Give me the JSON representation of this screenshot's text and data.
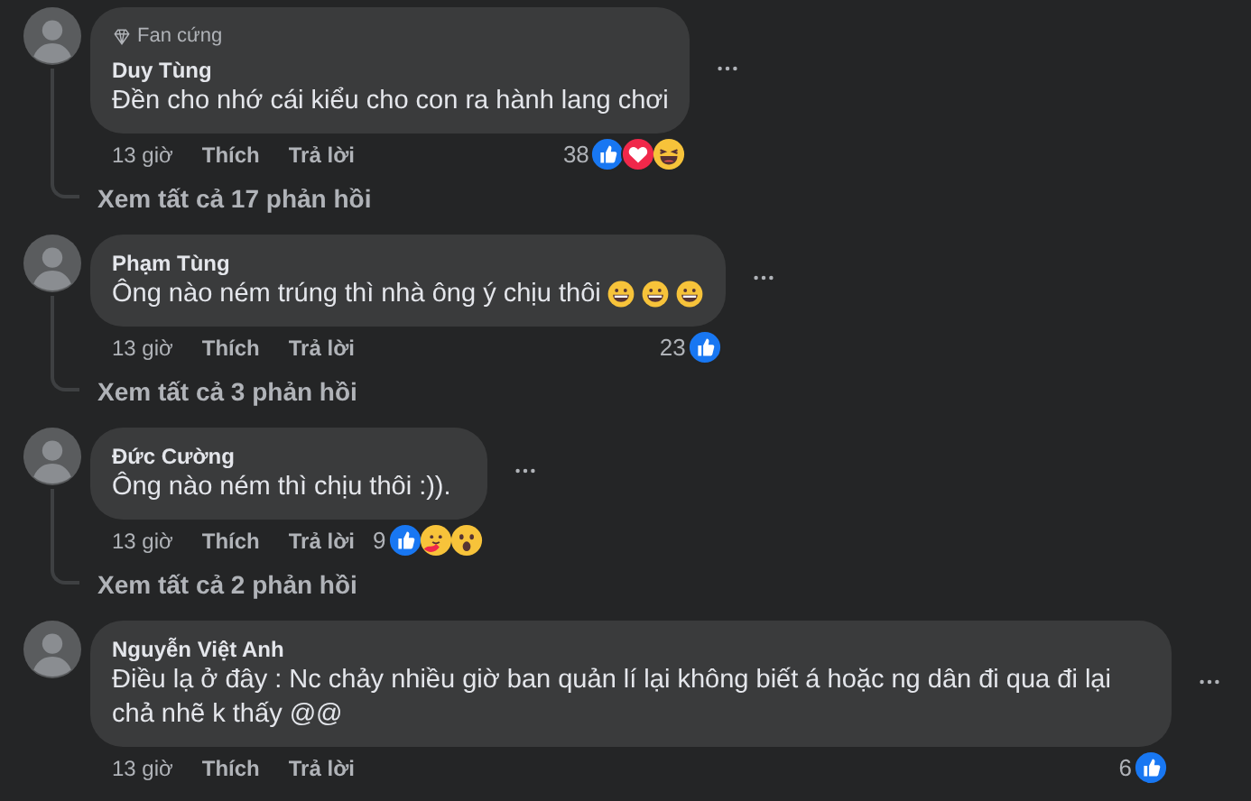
{
  "comments": [
    {
      "badge": "Fan cứng",
      "author": "Duy Tùng",
      "text": "Đền cho nhớ cái kiểu cho con ra hành lang chơi",
      "time": "13 giờ",
      "like": "Thích",
      "reply": "Trả lời",
      "reaction_count": "38",
      "reactions": [
        {
          "kind": "like"
        },
        {
          "kind": "love"
        },
        {
          "kind": "haha"
        }
      ],
      "replies": "Xem tất cả 17 phản hồi"
    },
    {
      "author": "Phạm Tùng",
      "text": "Ông nào ném trúng thì nhà ông ý chịu thôi",
      "emojis": [
        {
          "kind": "grin"
        },
        {
          "kind": "grin"
        },
        {
          "kind": "grin"
        }
      ],
      "time": "13 giờ",
      "like": "Thích",
      "reply": "Trả lời",
      "reaction_count": "23",
      "reactions": [
        {
          "kind": "like"
        }
      ],
      "replies": "Xem tất cả 3 phản hồi"
    },
    {
      "author": "Đức Cường",
      "text": "Ông nào ném thì chịu thôi :)).",
      "time": "13 giờ",
      "like": "Thích",
      "reply": "Trả lời",
      "reaction_count": "9",
      "reactions": [
        {
          "kind": "like"
        },
        {
          "kind": "care"
        },
        {
          "kind": "wow"
        }
      ],
      "replies": "Xem tất cả 2 phản hồi"
    },
    {
      "author": "Nguyễn Việt Anh",
      "text": "Điều lạ ở đây : Nc chảy nhiều giờ ban quản lí lại không biết á hoặc ng dân đi qua đi lại chả nhẽ k thấy @@",
      "time": "13 giờ",
      "like": "Thích",
      "reply": "Trả lời",
      "reaction_count": "6",
      "reactions": [
        {
          "kind": "like"
        }
      ]
    }
  ]
}
